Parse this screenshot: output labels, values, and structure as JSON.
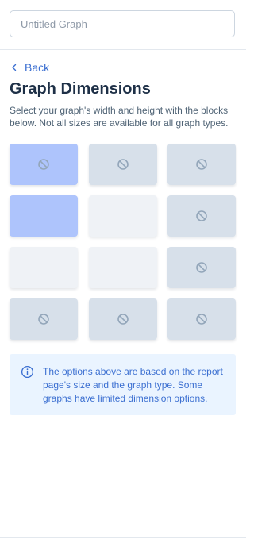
{
  "graph_title": {
    "value": "",
    "placeholder": "Untitled Graph"
  },
  "back": {
    "label": "Back"
  },
  "dimensions": {
    "title": "Graph Dimensions",
    "description": "Select your graph's width and height with the blocks below. Not all sizes are available for all graph types.",
    "grid": [
      [
        "selected-unavailable",
        "unavailable",
        "unavailable"
      ],
      [
        "selected",
        "available",
        "unavailable"
      ],
      [
        "available",
        "available",
        "unavailable"
      ],
      [
        "unavailable",
        "unavailable",
        "unavailable"
      ]
    ]
  },
  "notice": {
    "text": "The options above are based on the report page's size and the graph type. Some graphs have limited dimension options."
  },
  "colors": {
    "accent": "#3b6fd1",
    "selected": "#aec4fc",
    "available": "#eff2f6",
    "unavailable": "#d7e0ea",
    "notice_bg": "#eaf4ff"
  }
}
